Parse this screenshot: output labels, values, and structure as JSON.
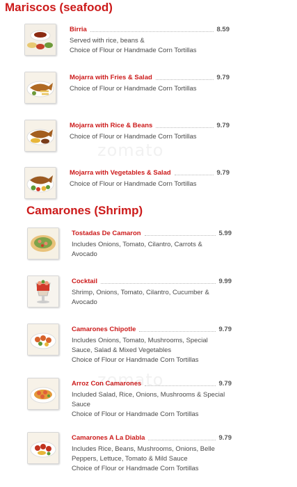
{
  "sections": [
    {
      "title": "Mariscos (seafood)",
      "items": [
        {
          "name": "Birria",
          "price": "8.59",
          "desc_lines": [
            "Served with rice, beans &",
            "Choice of Flour or Handmade Corn Tortillas"
          ],
          "icon": "birria-plate-photo"
        },
        {
          "name": "Mojarra with Fries & Salad",
          "price": "9.79",
          "desc_lines": [
            "Choice of Flour or Handmade Corn Tortillas"
          ],
          "icon": "fried-fish-fries-photo"
        },
        {
          "name": "Mojarra with Rice & Beans",
          "price": "9.79",
          "desc_lines": [
            "Choice of Flour or Handmade Corn Tortillas"
          ],
          "icon": "fried-fish-rice-photo"
        },
        {
          "name": "Mojarra with Vegetables & Salad",
          "price": "9.79",
          "desc_lines": [
            "Choice of Flour or Handmade Corn Tortillas"
          ],
          "icon": "fried-fish-vegetables-photo"
        }
      ]
    },
    {
      "title": "Camarones (Shrimp)",
      "items": [
        {
          "name": "Tostadas De Camaron",
          "price": "5.99",
          "desc_lines": [
            "Includes Onions, Tomato, Cilantro, Carrots &",
            "Avocado"
          ],
          "icon": "tostadas-photo"
        },
        {
          "name": "Cocktail",
          "price": "9.99",
          "desc_lines": [
            "Shrimp, Onions, Tomato, Cilantro, Cucumber &",
            "Avocado"
          ],
          "icon": "shrimp-cocktail-photo"
        },
        {
          "name": "Camarones Chipotle",
          "price": "9.79",
          "desc_lines": [
            "Includes Onions, Tomato, Mushrooms, Special",
            "Sauce, Salad & Mixed Vegetables",
            "Choice of Flour or Handmade Corn Tortillas"
          ],
          "icon": "shrimp-chipotle-photo"
        },
        {
          "name": "Arroz Con Camarones",
          "price": "9.79",
          "desc_lines": [
            "Included Salad, Rice, Onions, Mushrooms & Special",
            "Sauce",
            "Choice of Flour or Handmade Corn Tortillas"
          ],
          "icon": "shrimp-rice-photo"
        },
        {
          "name": "Camarones A La Diabla",
          "price": "9.79",
          "desc_lines": [
            "Includes Rice, Beans, Mushrooms, Onions, Belle",
            "Peppers, Lettuce, Tomato & Mild Sauce",
            "Choice of Flour or Handmade Corn Tortillas"
          ],
          "icon": "shrimp-diabla-photo"
        }
      ]
    }
  ],
  "watermark_text": "zomato",
  "colors": {
    "accent": "#cc1a1a",
    "text": "#4a4a4a",
    "price": "#555555"
  }
}
